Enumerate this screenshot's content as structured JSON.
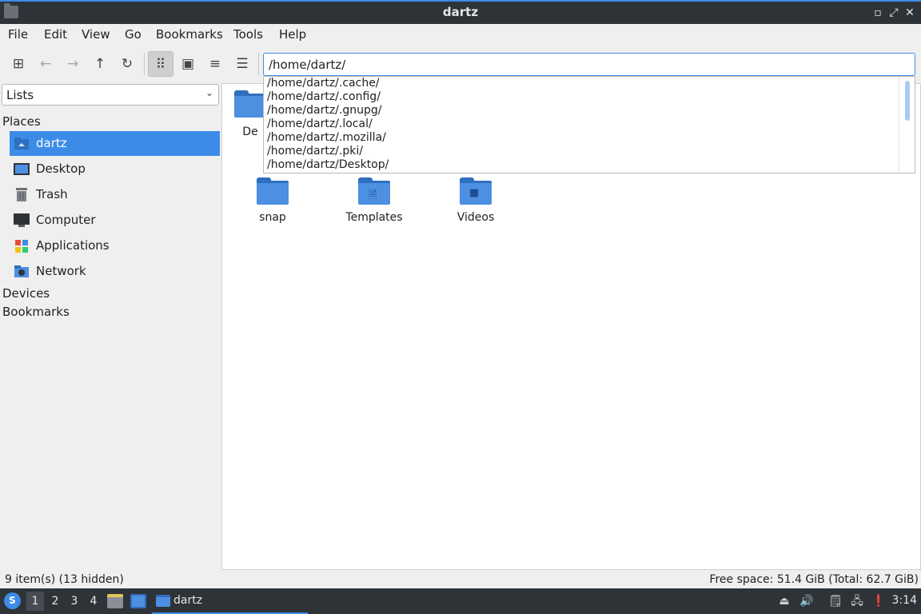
{
  "window": {
    "title": "dartz"
  },
  "menu": [
    "File",
    "Edit",
    "View",
    "Go",
    "Bookmarks",
    "Tools",
    "Help"
  ],
  "toolbar": {
    "buttons": [
      {
        "name": "new-window-icon",
        "glyph": "⊞"
      },
      {
        "name": "back-icon",
        "glyph": "←"
      },
      {
        "name": "forward-icon",
        "glyph": "→"
      },
      {
        "name": "up-icon",
        "glyph": "↑"
      },
      {
        "name": "reload-icon",
        "glyph": "↻"
      },
      {
        "name": "icon-view-icon",
        "glyph": "⠿"
      },
      {
        "name": "thumbnail-view-icon",
        "glyph": "▣"
      },
      {
        "name": "compact-view-icon",
        "glyph": "≡"
      },
      {
        "name": "detailed-list-view-icon",
        "glyph": "☰"
      }
    ],
    "path": "/home/dartz/"
  },
  "side": {
    "mode": "Lists",
    "places_heading": "Places",
    "places": [
      {
        "label": "dartz",
        "icon": "home-folder-icon",
        "selected": true
      },
      {
        "label": "Desktop",
        "icon": "desktop-icon"
      },
      {
        "label": "Trash",
        "icon": "trash-icon"
      },
      {
        "label": "Computer",
        "icon": "computer-icon"
      },
      {
        "label": "Applications",
        "icon": "applications-icon"
      },
      {
        "label": "Network",
        "icon": "network-icon"
      }
    ],
    "devices_heading": "Devices",
    "bookmarks_heading": "Bookmarks"
  },
  "files": [
    {
      "name": "De",
      "icon": "desktop-folder-icon",
      "partial": true
    },
    {
      "name": "snap",
      "icon": "folder-icon"
    },
    {
      "name": "Templates",
      "icon": "templates-folder-icon",
      "emblem": "🗎"
    },
    {
      "name": "Videos",
      "icon": "videos-folder-icon",
      "emblem": "■"
    }
  ],
  "autocomplete": [
    "/home/dartz/.cache/",
    "/home/dartz/.config/",
    "/home/dartz/.gnupg/",
    "/home/dartz/.local/",
    "/home/dartz/.mozilla/",
    "/home/dartz/.pki/",
    "/home/dartz/Desktop/"
  ],
  "status": {
    "items": "9 item(s) (13 hidden)",
    "free_space": "Free space: 51.4 GiB (Total: 62.7 GiB)"
  },
  "taskbar": {
    "workspaces": [
      "1",
      "2",
      "3",
      "4"
    ],
    "active_workspace": "1",
    "task_label": "dartz",
    "clock": "3:14"
  },
  "colors": {
    "accent": "#3c8ce7",
    "panel": "#2e3338",
    "folder": "#4d8fe0"
  }
}
